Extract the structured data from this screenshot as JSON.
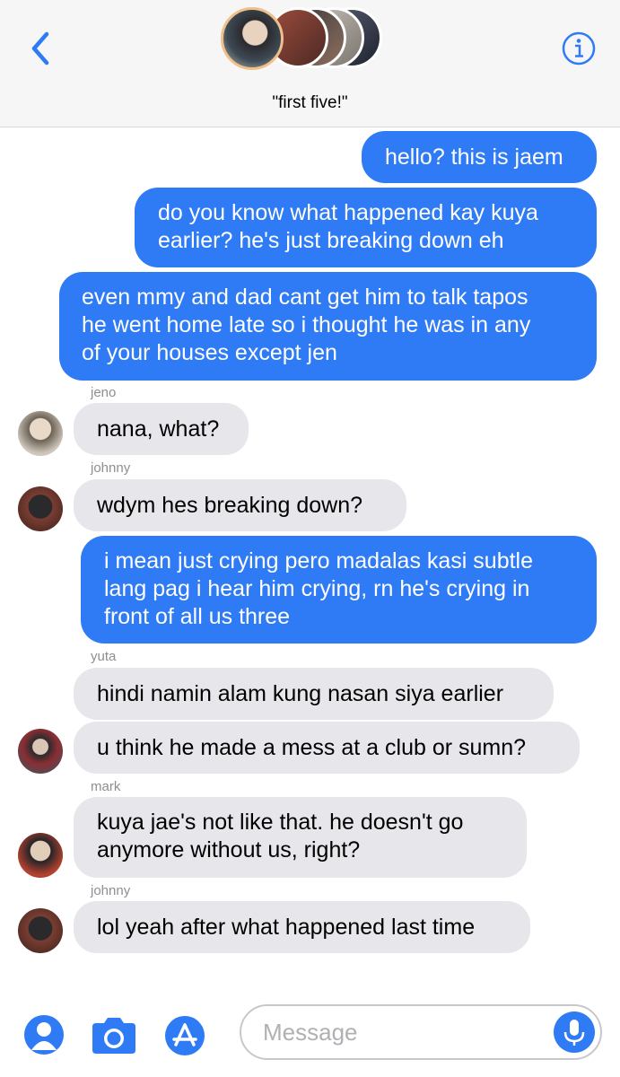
{
  "header": {
    "title": "\"first five!\"",
    "back_icon": "chevron-left-icon",
    "info_icon": "info-icon",
    "accent": "#2f7bf5"
  },
  "messages": [
    {
      "dir": "out",
      "text": "hello? this is jaem"
    },
    {
      "dir": "out",
      "lines": [
        "do you know what happened kay kuya",
        "earlier? he's just breaking down eh"
      ]
    },
    {
      "dir": "out",
      "lines": [
        "even mmy and dad cant get him to talk tapos",
        "he went home late so i thought he was in any",
        "of your houses except jen"
      ]
    },
    {
      "dir": "in",
      "sender": "jeno",
      "text": "nana, what?"
    },
    {
      "dir": "in",
      "sender": "johnny",
      "text": "wdym hes breaking down?"
    },
    {
      "dir": "out",
      "lines": [
        "i mean just crying pero madalas kasi subtle",
        "lang pag i hear him crying, rn he's crying in",
        "front of all us three"
      ]
    },
    {
      "dir": "in",
      "sender": "yuta",
      "text": "hindi namin alam kung nasan siya earlier"
    },
    {
      "dir": "in",
      "text": "u think he made a mess at a club or sumn?"
    },
    {
      "dir": "in",
      "sender": "mark",
      "lines": [
        "kuya jae's not like that. he doesn't go",
        "anymore without us, right?"
      ]
    },
    {
      "dir": "in",
      "sender": "johnny",
      "text": "lol yeah after what happened last time"
    }
  ],
  "composer": {
    "placeholder": "Message",
    "icons": [
      "memoji-icon",
      "camera-icon",
      "app-store-icon",
      "microphone-icon"
    ]
  }
}
